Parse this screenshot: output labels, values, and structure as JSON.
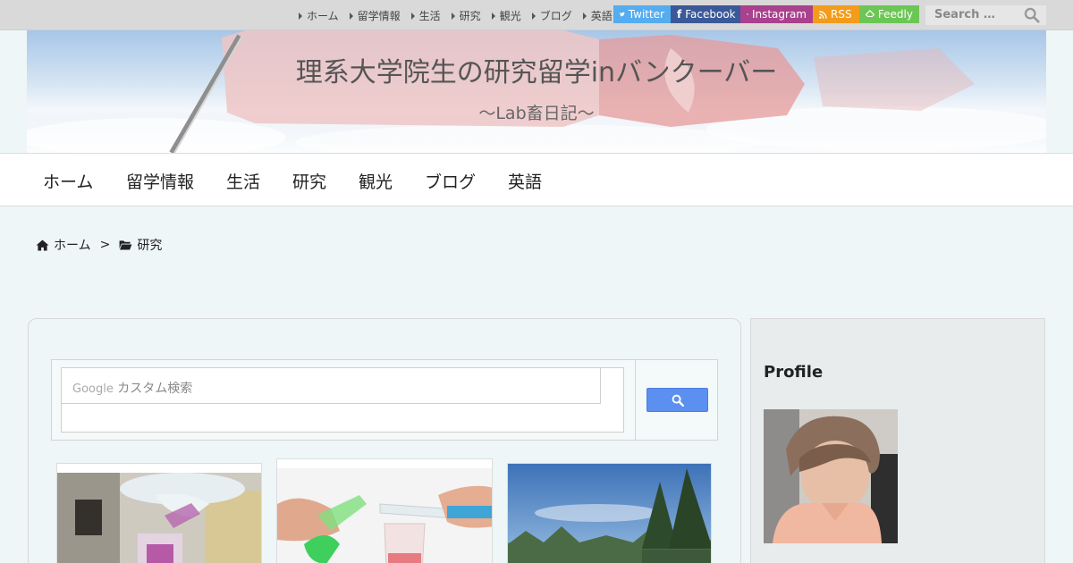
{
  "topbar": {
    "links": [
      "ホーム",
      "留学情報",
      "生活",
      "研究",
      "観光",
      "ブログ",
      "英語"
    ],
    "social": {
      "twitter": "Twitter",
      "facebook": "Facebook",
      "instagram": "Instagram",
      "rss": "RSS",
      "feedly": "Feedly"
    },
    "search_placeholder": "Search …"
  },
  "header": {
    "title": "理系大学院生の研究留学inバンクーバー",
    "subtitle": "～Lab畜日記～"
  },
  "nav": {
    "items": [
      "ホーム",
      "留学情報",
      "生活",
      "研究",
      "観光",
      "ブログ",
      "英語"
    ]
  },
  "breadcrumb": {
    "home": "ホーム",
    "separator": ">",
    "current": "研究"
  },
  "search": {
    "brand": "Google",
    "placeholder": "カスタム検索"
  },
  "sidebar": {
    "profile_title": "Profile"
  },
  "colors": {
    "twitter": "#55acee",
    "facebook": "#3b5998",
    "instagram": "#a9418d",
    "rss": "#f39c1c",
    "feedly": "#6cc655",
    "search_button": "#5b8ff0"
  }
}
